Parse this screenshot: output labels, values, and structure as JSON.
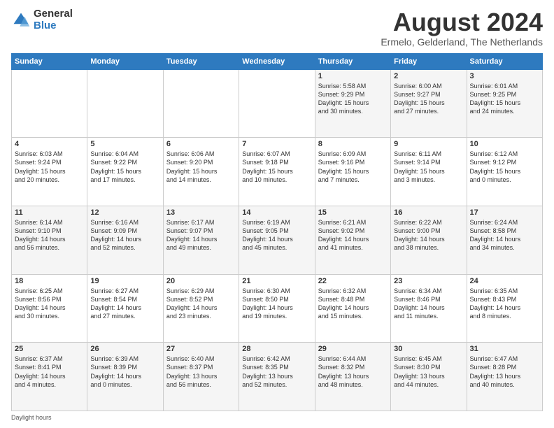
{
  "logo": {
    "general": "General",
    "blue": "Blue"
  },
  "title": {
    "month": "August 2024",
    "location": "Ermelo, Gelderland, The Netherlands"
  },
  "days_of_week": [
    "Sunday",
    "Monday",
    "Tuesday",
    "Wednesday",
    "Thursday",
    "Friday",
    "Saturday"
  ],
  "footer": "Daylight hours",
  "weeks": [
    [
      {
        "day": "",
        "info": ""
      },
      {
        "day": "",
        "info": ""
      },
      {
        "day": "",
        "info": ""
      },
      {
        "day": "",
        "info": ""
      },
      {
        "day": "1",
        "info": "Sunrise: 5:58 AM\nSunset: 9:29 PM\nDaylight: 15 hours\nand 30 minutes."
      },
      {
        "day": "2",
        "info": "Sunrise: 6:00 AM\nSunset: 9:27 PM\nDaylight: 15 hours\nand 27 minutes."
      },
      {
        "day": "3",
        "info": "Sunrise: 6:01 AM\nSunset: 9:25 PM\nDaylight: 15 hours\nand 24 minutes."
      }
    ],
    [
      {
        "day": "4",
        "info": "Sunrise: 6:03 AM\nSunset: 9:24 PM\nDaylight: 15 hours\nand 20 minutes."
      },
      {
        "day": "5",
        "info": "Sunrise: 6:04 AM\nSunset: 9:22 PM\nDaylight: 15 hours\nand 17 minutes."
      },
      {
        "day": "6",
        "info": "Sunrise: 6:06 AM\nSunset: 9:20 PM\nDaylight: 15 hours\nand 14 minutes."
      },
      {
        "day": "7",
        "info": "Sunrise: 6:07 AM\nSunset: 9:18 PM\nDaylight: 15 hours\nand 10 minutes."
      },
      {
        "day": "8",
        "info": "Sunrise: 6:09 AM\nSunset: 9:16 PM\nDaylight: 15 hours\nand 7 minutes."
      },
      {
        "day": "9",
        "info": "Sunrise: 6:11 AM\nSunset: 9:14 PM\nDaylight: 15 hours\nand 3 minutes."
      },
      {
        "day": "10",
        "info": "Sunrise: 6:12 AM\nSunset: 9:12 PM\nDaylight: 15 hours\nand 0 minutes."
      }
    ],
    [
      {
        "day": "11",
        "info": "Sunrise: 6:14 AM\nSunset: 9:10 PM\nDaylight: 14 hours\nand 56 minutes."
      },
      {
        "day": "12",
        "info": "Sunrise: 6:16 AM\nSunset: 9:09 PM\nDaylight: 14 hours\nand 52 minutes."
      },
      {
        "day": "13",
        "info": "Sunrise: 6:17 AM\nSunset: 9:07 PM\nDaylight: 14 hours\nand 49 minutes."
      },
      {
        "day": "14",
        "info": "Sunrise: 6:19 AM\nSunset: 9:05 PM\nDaylight: 14 hours\nand 45 minutes."
      },
      {
        "day": "15",
        "info": "Sunrise: 6:21 AM\nSunset: 9:02 PM\nDaylight: 14 hours\nand 41 minutes."
      },
      {
        "day": "16",
        "info": "Sunrise: 6:22 AM\nSunset: 9:00 PM\nDaylight: 14 hours\nand 38 minutes."
      },
      {
        "day": "17",
        "info": "Sunrise: 6:24 AM\nSunset: 8:58 PM\nDaylight: 14 hours\nand 34 minutes."
      }
    ],
    [
      {
        "day": "18",
        "info": "Sunrise: 6:25 AM\nSunset: 8:56 PM\nDaylight: 14 hours\nand 30 minutes."
      },
      {
        "day": "19",
        "info": "Sunrise: 6:27 AM\nSunset: 8:54 PM\nDaylight: 14 hours\nand 27 minutes."
      },
      {
        "day": "20",
        "info": "Sunrise: 6:29 AM\nSunset: 8:52 PM\nDaylight: 14 hours\nand 23 minutes."
      },
      {
        "day": "21",
        "info": "Sunrise: 6:30 AM\nSunset: 8:50 PM\nDaylight: 14 hours\nand 19 minutes."
      },
      {
        "day": "22",
        "info": "Sunrise: 6:32 AM\nSunset: 8:48 PM\nDaylight: 14 hours\nand 15 minutes."
      },
      {
        "day": "23",
        "info": "Sunrise: 6:34 AM\nSunset: 8:46 PM\nDaylight: 14 hours\nand 11 minutes."
      },
      {
        "day": "24",
        "info": "Sunrise: 6:35 AM\nSunset: 8:43 PM\nDaylight: 14 hours\nand 8 minutes."
      }
    ],
    [
      {
        "day": "25",
        "info": "Sunrise: 6:37 AM\nSunset: 8:41 PM\nDaylight: 14 hours\nand 4 minutes."
      },
      {
        "day": "26",
        "info": "Sunrise: 6:39 AM\nSunset: 8:39 PM\nDaylight: 14 hours\nand 0 minutes."
      },
      {
        "day": "27",
        "info": "Sunrise: 6:40 AM\nSunset: 8:37 PM\nDaylight: 13 hours\nand 56 minutes."
      },
      {
        "day": "28",
        "info": "Sunrise: 6:42 AM\nSunset: 8:35 PM\nDaylight: 13 hours\nand 52 minutes."
      },
      {
        "day": "29",
        "info": "Sunrise: 6:44 AM\nSunset: 8:32 PM\nDaylight: 13 hours\nand 48 minutes."
      },
      {
        "day": "30",
        "info": "Sunrise: 6:45 AM\nSunset: 8:30 PM\nDaylight: 13 hours\nand 44 minutes."
      },
      {
        "day": "31",
        "info": "Sunrise: 6:47 AM\nSunset: 8:28 PM\nDaylight: 13 hours\nand 40 minutes."
      }
    ]
  ]
}
